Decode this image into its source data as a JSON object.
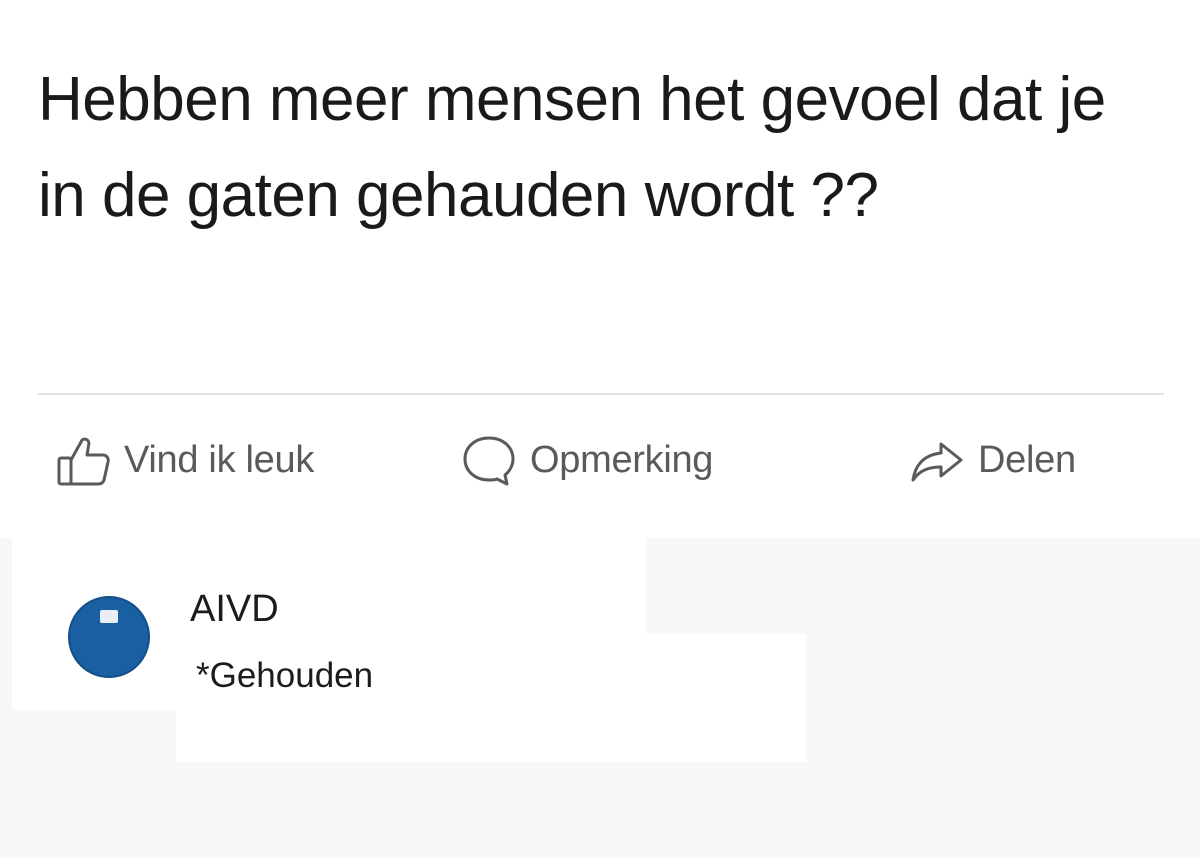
{
  "post": {
    "text": "Hebben meer mensen het gevoel dat je in de gaten gehauden wordt ??"
  },
  "actions": {
    "like_label": "Vind ik leuk",
    "comment_label": "Opmerking",
    "share_label": "Delen",
    "like_icon": "thumbs-up-icon",
    "comment_icon": "speech-bubble-icon",
    "share_icon": "share-arrow-icon"
  },
  "comment": {
    "author": "AIVD",
    "text": "*Gehouden",
    "avatar_color": "#1b5fa3"
  },
  "colors": {
    "action_text": "#5a5a5a",
    "divider": "#e3e3e3",
    "comment_background": "#f7f7f7"
  }
}
